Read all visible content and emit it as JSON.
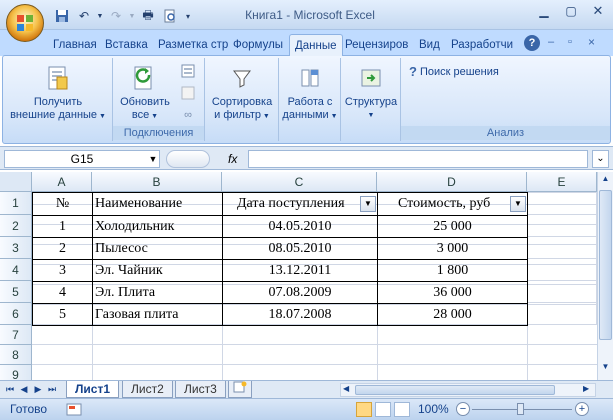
{
  "window": {
    "title": "Книга1 - Microsoft Excel"
  },
  "tabs": [
    "Главная",
    "Вставка",
    "Разметка стр",
    "Формулы",
    "Данные",
    "Рецензиров",
    "Вид",
    "Разработчи"
  ],
  "active_tab": "Данные",
  "ribbon": {
    "get_external_1": "Получить",
    "get_external_2": "внешние данные",
    "refresh_1": "Обновить",
    "refresh_2": "все",
    "sort_1": "Сортировка",
    "sort_2": "и фильтр",
    "data_tools_1": "Работа с",
    "data_tools_2": "данными",
    "outline": "Структура",
    "solver": "Поиск решения",
    "group_connections": "Подключения",
    "group_analysis": "Анализ"
  },
  "formula_bar": {
    "name_box": "G15",
    "fx": "fx",
    "formula": ""
  },
  "columns": [
    "A",
    "B",
    "C",
    "D",
    "E"
  ],
  "rows": [
    "1",
    "2",
    "3",
    "4",
    "5",
    "6",
    "7",
    "8",
    "9"
  ],
  "table": {
    "headers": [
      "№",
      "Наименование",
      "Дата поступления",
      "Стоимость, руб"
    ],
    "rows": [
      [
        "1",
        "Холодильник",
        "04.05.2010",
        "25 000"
      ],
      [
        "2",
        "Пылесос",
        "08.05.2010",
        "3 000"
      ],
      [
        "3",
        "Эл. Чайник",
        "13.12.2011",
        "1 800"
      ],
      [
        "4",
        "Эл. Плита",
        "07.08.2009",
        "36 000"
      ],
      [
        "5",
        "Газовая плита",
        "18.07.2008",
        "28 000"
      ]
    ]
  },
  "sheets": [
    "Лист1",
    "Лист2",
    "Лист3"
  ],
  "active_sheet": "Лист1",
  "status": {
    "ready": "Готово",
    "zoom": "100%"
  },
  "colors": {
    "accent": "#15428b",
    "ribbon": "#dbe8f8",
    "office_button": "#f5c14a"
  }
}
